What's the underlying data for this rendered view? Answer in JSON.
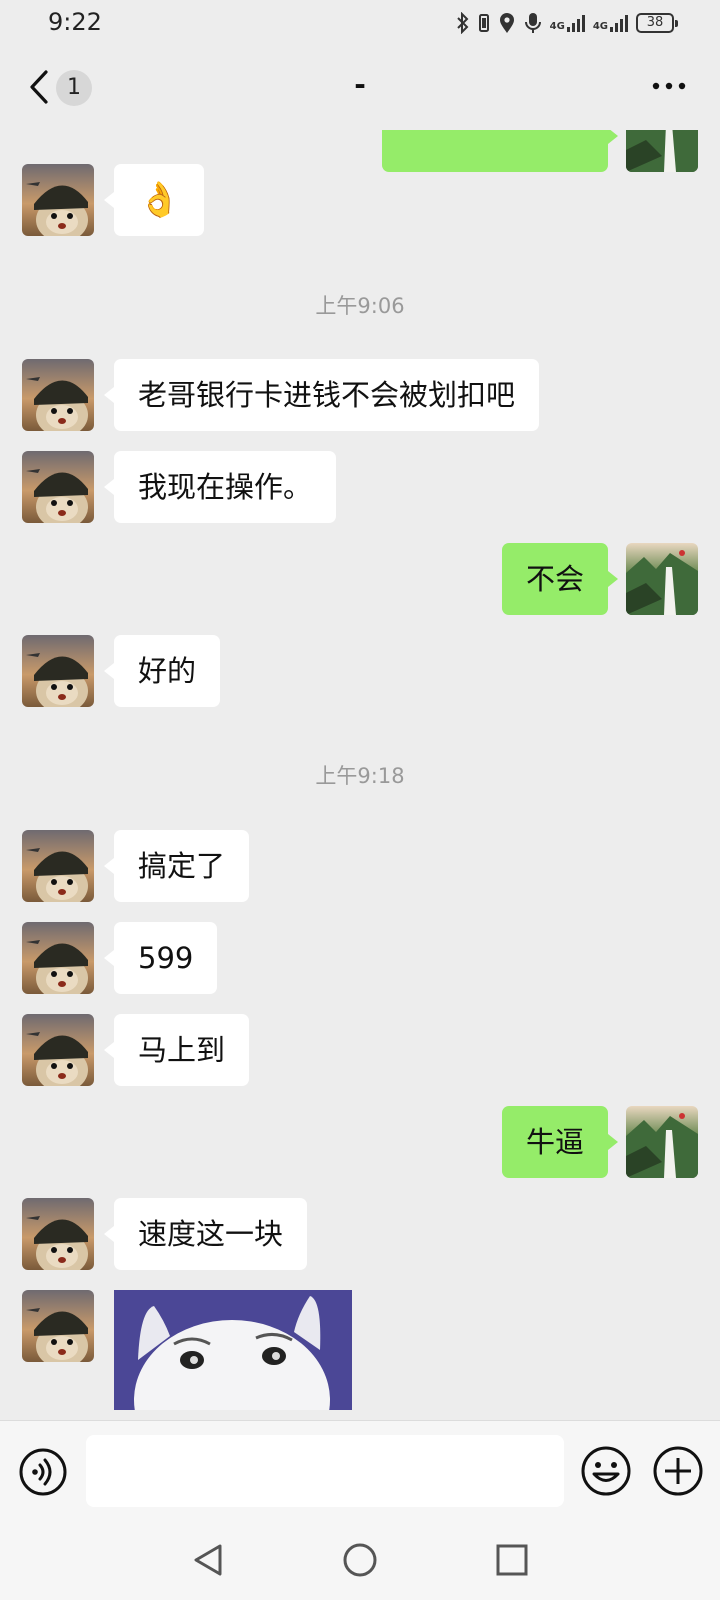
{
  "status_bar": {
    "time": "9:22",
    "network_1": "4G",
    "network_2": "4G",
    "battery": "38",
    "icons": [
      "bluetooth-icon",
      "vibrate-icon",
      "location-icon",
      "mic-icon",
      "signal-icon",
      "signal-icon",
      "battery-icon"
    ]
  },
  "header": {
    "back_icon": "chevron-left-icon",
    "unread_count": "1",
    "title": "-",
    "more_icon": "more-dots-icon"
  },
  "messages": [
    {
      "side": "right",
      "type": "partial",
      "text": ""
    },
    {
      "side": "left",
      "type": "emoji",
      "text": "👌"
    },
    {
      "type": "time",
      "text": "上午9:06"
    },
    {
      "side": "left",
      "type": "text",
      "text": "老哥银行卡进钱不会被划扣吧"
    },
    {
      "side": "left",
      "type": "text",
      "text": "我现在操作。"
    },
    {
      "side": "right",
      "type": "text",
      "text": "不会"
    },
    {
      "side": "left",
      "type": "text",
      "text": "好的"
    },
    {
      "type": "time",
      "text": "上午9:18"
    },
    {
      "side": "left",
      "type": "text",
      "text": "搞定了"
    },
    {
      "side": "left",
      "type": "text",
      "text": "599"
    },
    {
      "side": "left",
      "type": "text",
      "text": "马上到"
    },
    {
      "side": "right",
      "type": "text",
      "text": "牛逼"
    },
    {
      "side": "left",
      "type": "text",
      "text": "速度这一块"
    },
    {
      "side": "left",
      "type": "sticker",
      "text": ""
    }
  ],
  "input_bar": {
    "voice_icon": "voice-icon",
    "text_value": "",
    "emoji_icon": "emoji-icon",
    "plus_icon": "plus-icon"
  },
  "nav_bar": {
    "back_icon": "nav-back-icon",
    "home_icon": "nav-home-icon",
    "recent_icon": "nav-recent-icon"
  },
  "colors": {
    "background": "#ededed",
    "bubble_self": "#95ec69",
    "bubble_other": "#ffffff",
    "timestamp": "#999999"
  }
}
